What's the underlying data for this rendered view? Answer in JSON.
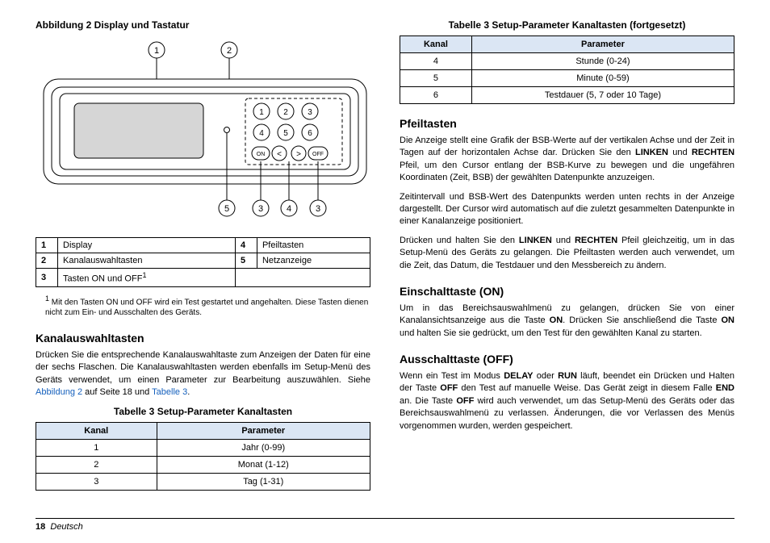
{
  "left": {
    "fig_caption": "Abbildung 2  Display und Tastatur",
    "callouts": {
      "top1": "1",
      "top2": "2",
      "bot1": "5",
      "bot2": "3",
      "bot3": "4",
      "bot4": "3"
    },
    "keypad": {
      "k1": "1",
      "k2": "2",
      "k3": "3",
      "k4": "4",
      "k5": "5",
      "k6": "6",
      "on": "ON",
      "off": "OFF",
      "lt": "<",
      "gt": ">"
    },
    "legend": {
      "r1c1n": "1",
      "r1c1": "Display",
      "r1c2n": "4",
      "r1c2": "Pfeiltasten",
      "r2c1n": "2",
      "r2c1": "Kanalauswahltasten",
      "r2c2n": "5",
      "r2c2": "Netzanzeige",
      "r3c1n": "3",
      "r3c1_a": "Tasten ON und OFF",
      "r3c1_sup": "1"
    },
    "footnote_sup": "1",
    "footnote": "Mit den Tasten ON und OFF wird ein Test gestartet und angehalten. Diese Tasten dienen nicht zum Ein- und Ausschalten des Geräts.",
    "h_kanal": "Kanalauswahltasten",
    "p_kanal_a": "Drücken Sie die entsprechende Kanalauswahltaste zum Anzeigen der Daten für eine der sechs Flaschen. Die Kanalauswahltasten werden ebenfalls im Setup-Menü des Geräts verwendet, um einen Parameter zur Bearbeitung auszuwählen. Siehe ",
    "p_kanal_link1": "Abbildung 2",
    "p_kanal_mid": " auf Seite 18 und ",
    "p_kanal_link2": "Tabelle 3",
    "p_kanal_end": ".",
    "tbl3_cap": "Tabelle 3  Setup-Parameter Kanaltasten",
    "tbl3_h1": "Kanal",
    "tbl3_h2": "Parameter",
    "tbl3_r1c1": "1",
    "tbl3_r1c2": "Jahr (0-99)",
    "tbl3_r2c1": "2",
    "tbl3_r2c2": "Monat (1-12)",
    "tbl3_r3c1": "3",
    "tbl3_r3c2": "Tag (1-31)"
  },
  "right": {
    "tbl3b_cap": "Tabelle 3  Setup-Parameter Kanaltasten (fortgesetzt)",
    "tbl3b_h1": "Kanal",
    "tbl3b_h2": "Parameter",
    "tbl3b_r1c1": "4",
    "tbl3b_r1c2": "Stunde (0-24)",
    "tbl3b_r2c1": "5",
    "tbl3b_r2c2": "Minute (0-59)",
    "tbl3b_r3c1": "6",
    "tbl3b_r3c2": "Testdauer (5, 7 oder 10 Tage)",
    "h_pfeil": "Pfeiltasten",
    "p_pfeil1_a": "Die Anzeige stellt eine Grafik der BSB-Werte auf der vertikalen Achse und der Zeit in Tagen auf der horizontalen Achse dar. Drücken Sie den ",
    "p_pfeil1_b": "LINKEN",
    "p_pfeil1_c": " und ",
    "p_pfeil1_d": "RECHTEN",
    "p_pfeil1_e": " Pfeil, um den Cursor entlang der BSB-Kurve zu bewegen und die ungefähren Koordinaten (Zeit, BSB) der gewählten Datenpunkte anzuzeigen.",
    "p_pfeil2": "Zeitintervall und BSB-Wert des Datenpunkts werden unten rechts in der Anzeige dargestellt. Der Cursor wird automatisch auf die zuletzt gesammelten Datenpunkte in einer Kanalanzeige positioniert.",
    "p_pfeil3_a": "Drücken und halten Sie den ",
    "p_pfeil3_b": "LINKEN",
    "p_pfeil3_c": " und ",
    "p_pfeil3_d": "RECHTEN",
    "p_pfeil3_e": " Pfeil gleichzeitig, um in das Setup-Menü des Geräts zu gelangen. Die Pfeiltasten werden auch verwendet, um die Zeit, das Datum, die Testdauer und den Messbereich zu ändern.",
    "h_on": "Einschalttaste (ON)",
    "p_on_a": "Um in das Bereichsauswahlmenü zu gelangen, drücken Sie von einer Kanalansichtsanzeige aus die Taste ",
    "p_on_b": "ON",
    "p_on_c": ". Drücken Sie anschließend die Taste ",
    "p_on_d": "ON",
    "p_on_e": " und halten Sie sie gedrückt, um den Test für den gewählten Kanal zu starten.",
    "h_off": "Ausschalttaste (OFF)",
    "p_off_a": "Wenn ein Test im Modus ",
    "p_off_b": "DELAY",
    "p_off_c": " oder ",
    "p_off_d": "RUN",
    "p_off_e": " läuft, beendet ein Drücken und Halten der Taste ",
    "p_off_f": "OFF",
    "p_off_g": " den Test auf manuelle Weise. Das Gerät zeigt in diesem Falle ",
    "p_off_h": "END",
    "p_off_i": " an. Die Taste ",
    "p_off_j": "OFF",
    "p_off_k": " wird auch verwendet, um das Setup-Menü des Geräts oder das Bereichsauswahlmenü zu verlassen. Änderungen, die vor Verlassen des Menüs vorgenommen wurden, werden gespeichert."
  },
  "footer": {
    "page": "18",
    "lang": "Deutsch"
  }
}
